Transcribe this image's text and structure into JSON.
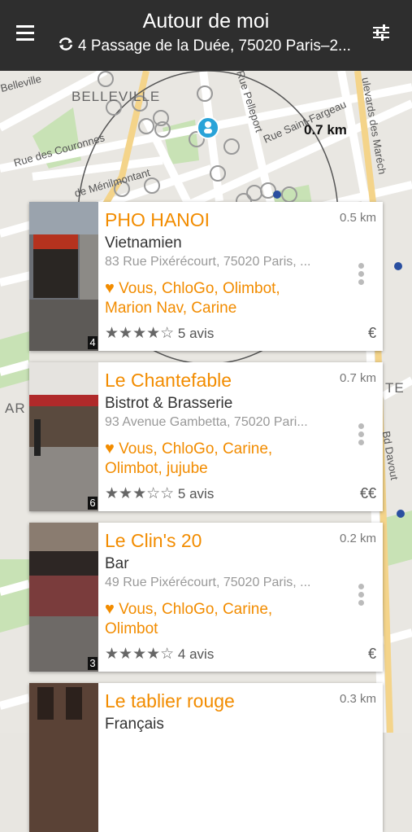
{
  "header": {
    "title": "Autour de moi",
    "address": "4 Passage de la Duée, 75020 Paris–2..."
  },
  "map": {
    "labels": {
      "belleville": "Belleville",
      "belleville_district": "BELLEVILLE",
      "couronnes": "Rue des Couronnes",
      "menilmontant": "de Ménilmontant",
      "pelleport": "Rue Pelleport",
      "saint_fargeau": "Rue Saint-Fargeau",
      "marechaux": "ulevards des Maréch",
      "bd_davout": "Bd Davout",
      "ar": "AR",
      "te": "TE"
    },
    "distance_label": "0.7 km"
  },
  "restaurants": [
    {
      "name": "PHO HANOI",
      "distance": "0.5 km",
      "category": "Vietnamien",
      "address": "83 Rue Pixérécourt, 75020 Paris, ...",
      "likes": "Vous, ChloGo, Olimbot, Marion Nav, Carine",
      "rating": 4,
      "reviews": "5 avis",
      "price": "€",
      "photos": "4"
    },
    {
      "name": "Le Chantefable",
      "distance": "0.7 km",
      "category": "Bistrot & Brasserie",
      "address": "93 Avenue Gambetta, 75020 Pari...",
      "likes": "Vous, ChloGo, Carine, Olimbot, jujube",
      "rating": 3,
      "reviews": "5 avis",
      "price": "€€",
      "photos": "6"
    },
    {
      "name": "Le Clin's 20",
      "distance": "0.2 km",
      "category": "Bar",
      "address": "49 Rue Pixérécourt, 75020 Paris, ...",
      "likes": "Vous, ChloGo, Carine, Olimbot",
      "rating": 4,
      "reviews": "4 avis",
      "price": "€",
      "photos": "3"
    },
    {
      "name": "Le tablier rouge",
      "distance": "0.3 km",
      "category": "Français",
      "address": "",
      "likes": "",
      "rating": 0,
      "reviews": "",
      "price": "",
      "photos": ""
    }
  ],
  "colors": {
    "accent": "#f28c00",
    "header_bg": "#2e2e2e"
  }
}
